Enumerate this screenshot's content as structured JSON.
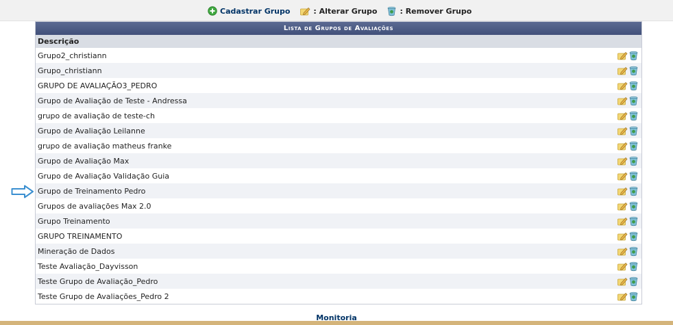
{
  "legend": {
    "add_label": "Cadastrar Grupo",
    "edit_label": ": Alterar Grupo",
    "remove_label": ": Remover Grupo"
  },
  "table": {
    "caption": "Lista de Grupos de Avaliações",
    "column_header": "Descrição",
    "rows": [
      "Grupo2_christiann",
      "Grupo_christiann",
      "GRUPO DE AVALIAÇÃO3_PEDRO",
      "Grupo de Avaliação de Teste - Andressa",
      "grupo de avaliação de teste-ch",
      "Grupo de Avaliação Leilanne",
      "grupo de avaliação matheus franke",
      "Grupo de Avaliação Max",
      "Grupo de Avaliação Validação Guia",
      "Grupo de Treinamento Pedro",
      "Grupos de avaliações Max 2.0",
      "Grupo Treinamento",
      "GRUPO TREINAMENTO",
      "Mineração de Dados",
      "Teste Avaliação_Dayvisson",
      "Teste Grupo de Avaliação_Pedro",
      "Teste Grupo de Avaliações_Pedro 2"
    ]
  },
  "footer": {
    "label": "Monitoria"
  },
  "icons": {
    "add": "plus-circle-icon",
    "edit": "pencil-edit-icon",
    "remove": "trash-bin-icon",
    "pointer": "arrow-right-icon"
  },
  "colors": {
    "caption_bg": "#4a5780",
    "header_bg": "#d9dde4",
    "link": "#003366",
    "footer_line": "#d4b47a",
    "pointer": "#3a8fd0"
  }
}
